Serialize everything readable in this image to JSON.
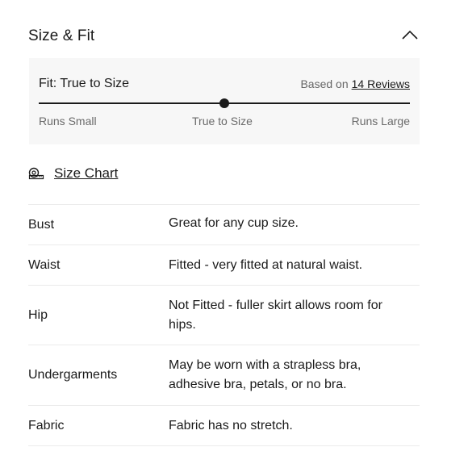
{
  "header": {
    "title": "Size & Fit",
    "collapse_icon": "chevron-up-icon"
  },
  "fit": {
    "label": "Fit: True to Size",
    "reviews_prefix": "Based on",
    "reviews_link": "14 Reviews",
    "slider_value_fraction": 0.5,
    "scale": {
      "left": "Runs Small",
      "middle": "True to Size",
      "right": "Runs Large"
    }
  },
  "size_chart": {
    "label": "Size Chart",
    "icon": "measuring-tape-icon"
  },
  "rows": [
    {
      "label": "Bust",
      "value": "Great for any cup size."
    },
    {
      "label": "Waist",
      "value": "Fitted - very fitted at natural waist."
    },
    {
      "label": "Hip",
      "value": "Not Fitted - fuller skirt allows room for hips."
    },
    {
      "label": "Undergarments",
      "value": "May be worn with a strapless bra, adhesive bra, petals, or no bra."
    },
    {
      "label": "Fabric",
      "value": "Fabric has no stretch."
    }
  ]
}
